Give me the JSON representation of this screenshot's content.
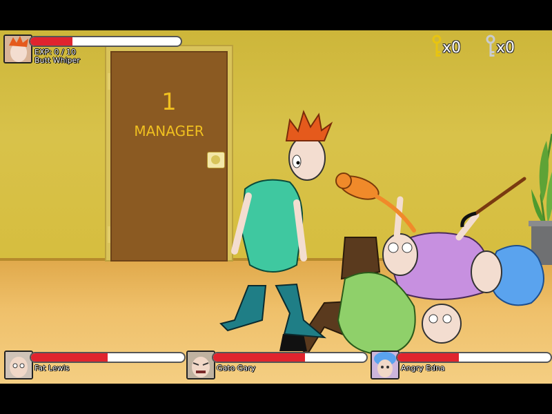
{
  "player": {
    "name": "Butt Whiper",
    "exp_text": "EXP: 0 / 10",
    "health": 0.28,
    "portrait_icon": "red-haired-boy-portrait-icon"
  },
  "keys": {
    "gold": {
      "count": "x0",
      "icon": "gold-key-icon"
    },
    "silver": {
      "count": "x0",
      "icon": "silver-key-icon"
    }
  },
  "scene": {
    "door_number": "1",
    "door_label": "MANAGER"
  },
  "enemies": [
    {
      "name": "Fat Lewis",
      "health": 0.5,
      "portrait_icon": "bald-old-man-portrait-icon"
    },
    {
      "name": "Gato Gary",
      "health": 0.6,
      "portrait_icon": "angry-old-man-portrait-icon"
    },
    {
      "name": "Angry Edna",
      "health": 0.4,
      "portrait_icon": "blue-haired-granny-portrait-icon"
    }
  ],
  "colors": {
    "health_bar": "#e0242e",
    "door_text": "#f0c020",
    "wall": "#d6bd3d",
    "floor": "#efc06a"
  }
}
